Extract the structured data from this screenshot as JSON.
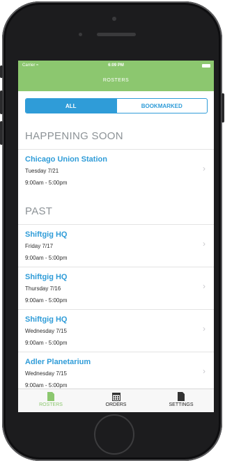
{
  "status_bar": {
    "carrier": "Carrier",
    "time": "6:09 PM"
  },
  "nav": {
    "title": "ROSTERS"
  },
  "segmented": {
    "all_label": "ALL",
    "bookmarked_label": "BOOKMARKED",
    "selected": "ALL"
  },
  "sections": [
    {
      "title": "HAPPENING SOON",
      "items": [
        {
          "title": "Chicago Union Station",
          "date": "Tuesday 7/21",
          "time": "9:00am - 5:00pm"
        }
      ]
    },
    {
      "title": "PAST",
      "items": [
        {
          "title": "Shiftgig HQ",
          "date": "Friday 7/17",
          "time": "9:00am - 5:00pm"
        },
        {
          "title": "Shiftgig HQ",
          "date": "Thursday 7/16",
          "time": "9:00am - 5:00pm"
        },
        {
          "title": "Shiftgig HQ",
          "date": "Wednesday 7/15",
          "time": "9:00am - 5:00pm"
        },
        {
          "title": "Adler Planetarium",
          "date": "Wednesday 7/15",
          "time": "9:00am - 5:00pm"
        }
      ]
    }
  ],
  "tabbar": {
    "tabs": [
      {
        "label": "ROSTERS",
        "icon": "document-icon",
        "active": true
      },
      {
        "label": "ORDERS",
        "icon": "calendar-icon",
        "active": false
      },
      {
        "label": "SETTINGS",
        "icon": "document-icon",
        "active": false
      }
    ]
  },
  "colors": {
    "accent_green": "#8cc76f",
    "link_blue": "#2f9cd8",
    "header_gray": "#8c9296"
  }
}
